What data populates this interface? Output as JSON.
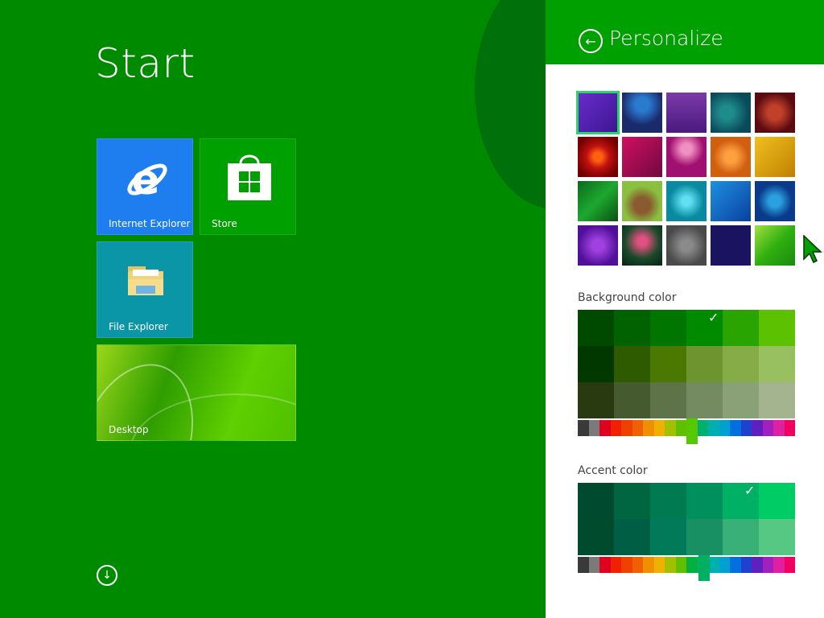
{
  "start": {
    "title": "Start",
    "tiles": {
      "ie": "Internet Explorer",
      "store": "Store",
      "file_explorer": "File Explorer",
      "desktop": "Desktop"
    }
  },
  "personalize": {
    "title": "Personalize",
    "background_label": "Background color",
    "accent_label": "Accent color"
  }
}
